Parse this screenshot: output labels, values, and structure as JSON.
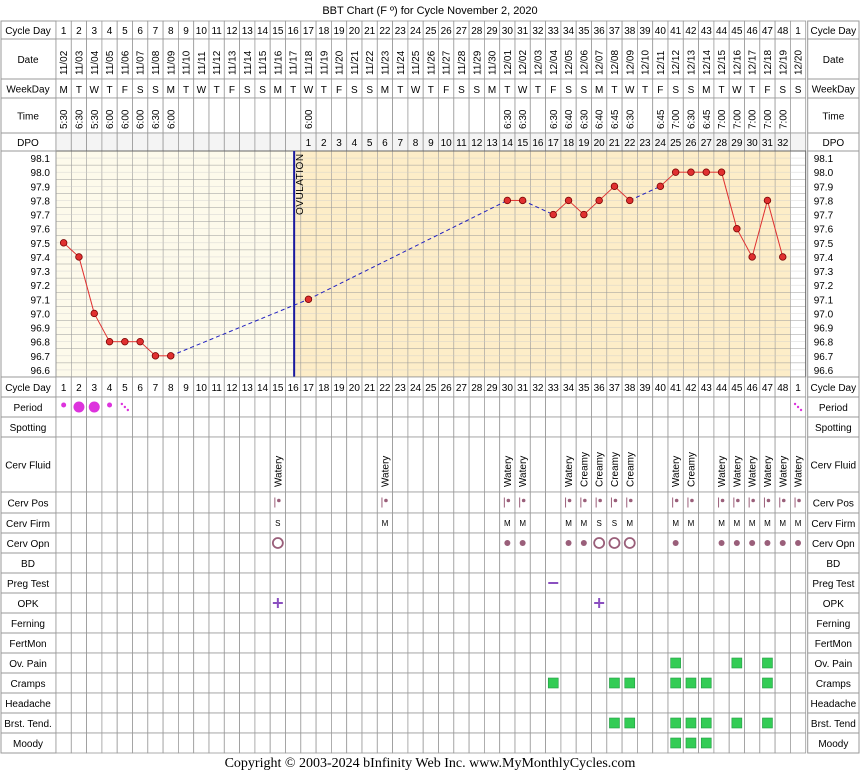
{
  "title": "BBT Chart (F º) for Cycle November 2, 2020",
  "copyright": "Copyright © 2003-2024 bInfinity Web Inc.    www.MyMonthlyCycles.com",
  "colors": {
    "grid": "#999999",
    "pre_bg": "#fdfaeb",
    "post_bg": "#fdedc8",
    "line": "#e03030",
    "dot": "#e03030",
    "coverline": "#2020c0",
    "ovulation_line": "#1a1aa0",
    "period": "#dd33dd",
    "symptom": "#33cc55",
    "cerv": "#9a5f7a",
    "opk": "#8a4fc0",
    "row_header_bg": "#eeeeee"
  },
  "labels": {
    "cycle_day": "Cycle Day",
    "date": "Date",
    "weekday": "WeekDay",
    "time": "Time",
    "dpo": "DPO",
    "ovulation": "OVULATION",
    "bottom_rows": [
      "Period",
      "Spotting",
      "Cerv Fluid",
      "Cerv Pos",
      "Cerv Firm",
      "Cerv Opn",
      "BD",
      "Preg Test",
      "OPK",
      "Ferning",
      "FertMon",
      "Ov. Pain",
      "Cramps",
      "Headache",
      "Brst. Tend.",
      "Moody"
    ],
    "bottom_rows_right": [
      "Period",
      "Spotting",
      "Cerv Fluid",
      "Cerv Pos",
      "Cerv Firm",
      "Cerv Opn",
      "BD",
      "Preg Test",
      "OPK",
      "Ferning",
      "FertMon",
      "Ov. Pain",
      "Cramps",
      "Headache",
      "Brst. Tend",
      "Moody"
    ]
  },
  "cycle_days": [
    "1",
    "2",
    "3",
    "4",
    "5",
    "6",
    "7",
    "8",
    "9",
    "10",
    "11",
    "12",
    "13",
    "14",
    "15",
    "16",
    "17",
    "18",
    "19",
    "20",
    "21",
    "22",
    "23",
    "24",
    "25",
    "26",
    "27",
    "28",
    "29",
    "30",
    "31",
    "32",
    "33",
    "34",
    "35",
    "36",
    "37",
    "38",
    "39",
    "40",
    "41",
    "42",
    "43",
    "44",
    "45",
    "46",
    "47",
    "48",
    "1"
  ],
  "dates": [
    "11/02",
    "11/03",
    "11/04",
    "11/05",
    "11/06",
    "11/07",
    "11/08",
    "11/09",
    "11/10",
    "11/11",
    "11/12",
    "11/13",
    "11/14",
    "11/15",
    "11/16",
    "11/17",
    "11/18",
    "11/19",
    "11/20",
    "11/21",
    "11/22",
    "11/23",
    "11/24",
    "11/25",
    "11/26",
    "11/27",
    "11/28",
    "11/29",
    "11/30",
    "12/01",
    "12/02",
    "12/03",
    "12/04",
    "12/05",
    "12/06",
    "12/07",
    "12/08",
    "12/09",
    "12/10",
    "12/11",
    "12/12",
    "12/13",
    "12/14",
    "12/15",
    "12/16",
    "12/17",
    "12/18",
    "12/19",
    "12/20"
  ],
  "weekdays": [
    "M",
    "T",
    "W",
    "T",
    "F",
    "S",
    "S",
    "M",
    "T",
    "W",
    "T",
    "F",
    "S",
    "S",
    "M",
    "T",
    "W",
    "T",
    "F",
    "S",
    "S",
    "M",
    "T",
    "W",
    "T",
    "F",
    "S",
    "S",
    "M",
    "T",
    "W",
    "T",
    "F",
    "S",
    "S",
    "M",
    "T",
    "W",
    "T",
    "F",
    "S",
    "S",
    "M",
    "T",
    "W",
    "T",
    "F",
    "S",
    "S"
  ],
  "times": [
    "5:30",
    "6:30",
    "5:30",
    "6:00",
    "6:00",
    "6:00",
    "6:30",
    "6:00",
    "",
    "",
    "",
    "",
    "",
    "",
    "",
    "",
    "6:00",
    "",
    "",
    "",
    "",
    "",
    "",
    "",
    "",
    "",
    "",
    "",
    "",
    "6:30",
    "6:30",
    "",
    "6:30",
    "6:40",
    "6:30",
    "6:40",
    "6:45",
    "6:30",
    "",
    "6:45",
    "7:00",
    "6:30",
    "6:45",
    "7:00",
    "7:00",
    "7:00",
    "7:00",
    "7:00",
    ""
  ],
  "dpo": [
    "",
    "",
    "",
    "",
    "",
    "",
    "",
    "",
    "",
    "",
    "",
    "",
    "",
    "",
    "",
    "",
    "1",
    "2",
    "3",
    "4",
    "5",
    "6",
    "7",
    "8",
    "9",
    "10",
    "11",
    "12",
    "13",
    "14",
    "15",
    "16",
    "17",
    "18",
    "19",
    "20",
    "21",
    "22",
    "23",
    "24",
    "25",
    "26",
    "27",
    "28",
    "29",
    "30",
    "31",
    "32",
    ""
  ],
  "chart_data": {
    "type": "line",
    "title": "BBT Chart (F º) for Cycle November 2, 2020",
    "xlabel": "Cycle Day",
    "ylabel": "",
    "ylim": [
      96.6,
      98.1
    ],
    "y_ticks": [
      "98.1",
      "98.0",
      "97.9",
      "97.8",
      "97.7",
      "97.6",
      "97.5",
      "97.4",
      "97.3",
      "97.2",
      "97.1",
      "97.0",
      "96.9",
      "96.8",
      "96.7",
      "96.6"
    ],
    "ovulation_day": 16,
    "series": [
      {
        "x": [
          1,
          2,
          3,
          4,
          5,
          6,
          7,
          8,
          17,
          30,
          31,
          33,
          34,
          35,
          36,
          37,
          38,
          40,
          41,
          42,
          43,
          44,
          45,
          46,
          47,
          48
        ],
        "values": [
          97.5,
          97.4,
          97.0,
          96.8,
          96.8,
          96.8,
          96.7,
          96.7,
          97.1,
          97.8,
          97.8,
          97.7,
          97.8,
          97.7,
          97.8,
          97.9,
          97.8,
          97.9,
          98.0,
          98.0,
          98.0,
          98.0,
          97.6,
          97.4,
          97.8,
          97.4
        ]
      }
    ]
  },
  "observations": {
    "period": [
      {
        "day": 1,
        "size": "small"
      },
      {
        "day": 2,
        "size": "large"
      },
      {
        "day": 3,
        "size": "large"
      },
      {
        "day": 4,
        "size": "small"
      },
      {
        "day": 5,
        "size": "dots"
      },
      {
        "day": 49,
        "size": "dots"
      }
    ],
    "cerv_fluid": [
      {
        "day": 15,
        "text": "Watery"
      },
      {
        "day": 22,
        "text": "Watery"
      },
      {
        "day": 30,
        "text": "Watery"
      },
      {
        "day": 31,
        "text": "Watery"
      },
      {
        "day": 34,
        "text": "Watery"
      },
      {
        "day": 35,
        "text": "Creamy"
      },
      {
        "day": 36,
        "text": "Creamy"
      },
      {
        "day": 37,
        "text": "Creamy"
      },
      {
        "day": 38,
        "text": "Creamy"
      },
      {
        "day": 41,
        "text": "Watery"
      },
      {
        "day": 42,
        "text": "Creamy"
      },
      {
        "day": 44,
        "text": "Watery"
      },
      {
        "day": 45,
        "text": "Watery"
      },
      {
        "day": 46,
        "text": "Watery"
      },
      {
        "day": 47,
        "text": "Watery"
      },
      {
        "day": 48,
        "text": "Watery"
      },
      {
        "day": 49,
        "text": "Watery"
      }
    ],
    "cerv_pos_days": [
      15,
      22,
      30,
      31,
      34,
      35,
      36,
      37,
      38,
      41,
      42,
      44,
      45,
      46,
      47,
      48,
      49
    ],
    "cerv_firm": [
      {
        "day": 15,
        "text": "S"
      },
      {
        "day": 22,
        "text": "M"
      },
      {
        "day": 30,
        "text": "M"
      },
      {
        "day": 31,
        "text": "M"
      },
      {
        "day": 34,
        "text": "M"
      },
      {
        "day": 35,
        "text": "M"
      },
      {
        "day": 36,
        "text": "S"
      },
      {
        "day": 37,
        "text": "S"
      },
      {
        "day": 38,
        "text": "M"
      },
      {
        "day": 41,
        "text": "M"
      },
      {
        "day": 42,
        "text": "M"
      },
      {
        "day": 44,
        "text": "M"
      },
      {
        "day": 45,
        "text": "M"
      },
      {
        "day": 46,
        "text": "M"
      },
      {
        "day": 47,
        "text": "M"
      },
      {
        "day": 48,
        "text": "M"
      },
      {
        "day": 49,
        "text": "M"
      }
    ],
    "cerv_opn": [
      {
        "day": 15,
        "type": "open"
      },
      {
        "day": 30,
        "type": "dot"
      },
      {
        "day": 31,
        "type": "dot"
      },
      {
        "day": 34,
        "type": "dot"
      },
      {
        "day": 35,
        "type": "dot"
      },
      {
        "day": 36,
        "type": "open"
      },
      {
        "day": 37,
        "type": "open"
      },
      {
        "day": 38,
        "type": "open"
      },
      {
        "day": 41,
        "type": "dot"
      },
      {
        "day": 44,
        "type": "dot"
      },
      {
        "day": 45,
        "type": "dot"
      },
      {
        "day": 46,
        "type": "dot"
      },
      {
        "day": 47,
        "type": "dot"
      },
      {
        "day": 48,
        "type": "dot"
      },
      {
        "day": 49,
        "type": "dot"
      }
    ],
    "preg_test": [
      {
        "day": 33,
        "type": "negative"
      }
    ],
    "opk": [
      {
        "day": 15,
        "type": "positive"
      },
      {
        "day": 36,
        "type": "positive"
      }
    ],
    "ov_pain": [
      41,
      45,
      47
    ],
    "cramps": [
      33,
      37,
      38,
      41,
      42,
      43,
      47
    ],
    "brst_tend": [
      37,
      38,
      41,
      42,
      43,
      45,
      47
    ],
    "moody": [
      41,
      42,
      43
    ]
  }
}
